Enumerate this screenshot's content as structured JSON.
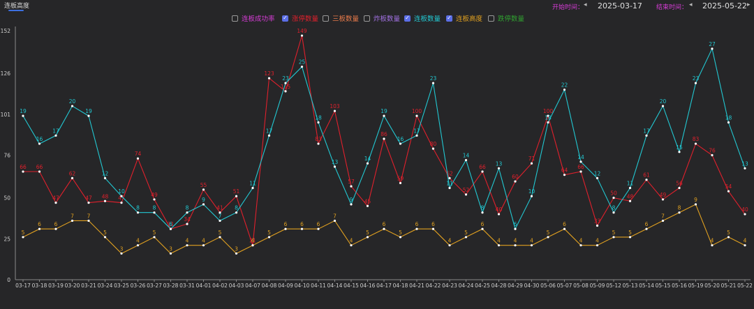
{
  "tab": {
    "label": "连板高度"
  },
  "start": {
    "label": "开始时间：",
    "date": "2025-03-17",
    "color": "#d63cd6"
  },
  "end": {
    "label": "结束时间：",
    "date": "2025-05-22",
    "color": "#d63cd6"
  },
  "icons": {
    "prev": "triangle-left-icon"
  },
  "legend": [
    {
      "label": "连板成功率",
      "checked": false,
      "color": "#d63cd6"
    },
    {
      "label": "涨停数量",
      "checked": true,
      "color": "#e0202c"
    },
    {
      "label": "三板数量",
      "checked": false,
      "color": "#e87a4a"
    },
    {
      "label": "炸板数量",
      "checked": false,
      "color": "#a070e0"
    },
    {
      "label": "连板数量",
      "checked": true,
      "color": "#22c8d2"
    },
    {
      "label": "连板高度",
      "checked": true,
      "color": "#e0a020"
    },
    {
      "label": "跌停数量",
      "checked": false,
      "color": "#30a030"
    }
  ],
  "chart_data": {
    "type": "line",
    "categories": [
      "03-17",
      "03-18",
      "03-19",
      "03-20",
      "03-21",
      "03-24",
      "03-25",
      "03-26",
      "03-27",
      "03-28",
      "03-31",
      "04-01",
      "04-02",
      "04-03",
      "04-07",
      "04-08",
      "04-09",
      "04-10",
      "04-11",
      "04-14",
      "04-15",
      "04-16",
      "04-17",
      "04-18",
      "04-21",
      "04-22",
      "04-23",
      "04-24",
      "04-25",
      "04-28",
      "04-29",
      "04-30",
      "05-06",
      "05-07",
      "05-08",
      "05-09",
      "05-12",
      "05-13",
      "05-14",
      "05-15",
      "05-16",
      "05-19",
      "05-20",
      "05-21",
      "05-22"
    ],
    "yticks": [
      0,
      25,
      50,
      76,
      101,
      126,
      152
    ],
    "ylim": [
      0,
      152
    ],
    "series": [
      {
        "name": "涨停数量",
        "color": "#e0202c",
        "values": [
          66,
          66,
          47,
          62,
          47,
          48,
          47,
          74,
          49,
          31,
          34,
          55,
          41,
          51,
          21,
          123,
          115,
          149,
          83,
          103,
          57,
          45,
          86,
          59,
          100,
          80,
          62,
          52,
          66,
          40,
          60,
          71,
          100,
          64,
          66,
          33,
          50,
          48,
          61,
          49,
          56,
          83,
          76,
          54,
          40
        ],
        "labels": [
          66,
          66,
          47,
          62,
          47,
          48,
          47,
          74,
          49,
          31,
          34,
          55,
          41,
          51,
          21,
          123,
          115,
          149,
          83,
          103,
          57,
          45,
          86,
          59,
          100,
          80,
          62,
          52,
          66,
          40,
          60,
          71,
          100,
          64,
          66,
          33,
          50,
          48,
          61,
          49,
          56,
          83,
          76,
          54,
          40
        ]
      },
      {
        "name": "连板数量",
        "color": "#22c8d2",
        "values": [
          100,
          83,
          88,
          106,
          100,
          62,
          51,
          41,
          41,
          31,
          41,
          46,
          36,
          41,
          56,
          88,
          120,
          130,
          96,
          69,
          46,
          71,
          100,
          83,
          88,
          120,
          56,
          73,
          41,
          68,
          31,
          51,
          96,
          116,
          72,
          62,
          41,
          56,
          88,
          106,
          78,
          120,
          141,
          96,
          68
        ],
        "labels": [
          19,
          16,
          17,
          20,
          19,
          12,
          10,
          8,
          8,
          6,
          8,
          9,
          7,
          8,
          11,
          17,
          23,
          25,
          18,
          13,
          9,
          14,
          19,
          16,
          17,
          23,
          11,
          14,
          8,
          13,
          6,
          10,
          18,
          22,
          14,
          12,
          8,
          11,
          17,
          20,
          15,
          23,
          27,
          18,
          13
        ]
      },
      {
        "name": "连板高度",
        "color": "#e0a020",
        "values": [
          26,
          31,
          31,
          36,
          36,
          26,
          16,
          21,
          26,
          16,
          21,
          21,
          26,
          16,
          21,
          26,
          31,
          31,
          31,
          36,
          21,
          26,
          31,
          26,
          31,
          31,
          21,
          26,
          31,
          21,
          21,
          21,
          26,
          31,
          21,
          21,
          26,
          26,
          31,
          36,
          41,
          46,
          21,
          26,
          21
        ],
        "labels": [
          5,
          6,
          6,
          7,
          7,
          5,
          3,
          4,
          5,
          3,
          4,
          4,
          5,
          3,
          4,
          5,
          6,
          6,
          6,
          7,
          4,
          5,
          6,
          5,
          6,
          6,
          4,
          5,
          6,
          4,
          4,
          4,
          5,
          6,
          4,
          4,
          5,
          5,
          6,
          7,
          8,
          9,
          4,
          5,
          4
        ]
      }
    ]
  }
}
